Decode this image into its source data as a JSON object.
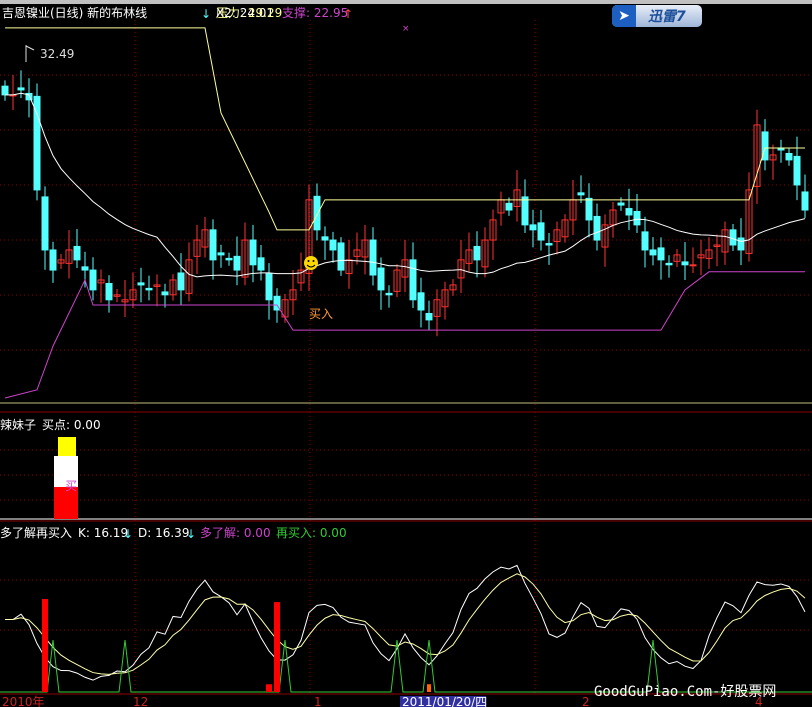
{
  "header": {
    "title": "吉恩镍业(日线) 新的布林线",
    "x2_label": "X2: 24.01",
    "pressure_label": "压力: 29.29",
    "support_label": "支撑: 22.95",
    "max_label": "32.49"
  },
  "panel2": {
    "title": "辣妹子",
    "buy_point": "买点: 0.00",
    "bar_text": "买"
  },
  "panel3": {
    "title": "多了解再买入",
    "k": "K: 16.19",
    "d": "D: 16.39",
    "dlj": "多了解: 0.00",
    "zmr": "再买入: 0.00"
  },
  "annotations": {
    "buy": "买入"
  },
  "time_axis": [
    "2010年",
    "12",
    "1",
    "2011/01/20/四",
    "2",
    "4"
  ],
  "logo": {
    "text": "迅雷7"
  },
  "watermark": "GoodGuPiao.Com-好股票网",
  "colors": {
    "up": "#ff3232",
    "down": "#54ffff",
    "ma": "#ffffff",
    "pressure": "#ffff99",
    "support": "#cc44cc",
    "grid": "#8b0000",
    "kd_green": "#33cc33"
  },
  "chart_data": {
    "type": "candlestick",
    "ylim": [
      20.38,
      33.59
    ],
    "close": [
      31.02,
      31.02,
      31.19,
      30.85,
      27.76,
      25.7,
      25.01,
      25.36,
      25.7,
      25.36,
      25.01,
      24.33,
      24.67,
      23.99,
      24.16,
      23.99,
      24.33,
      24.5,
      24.33,
      24.5,
      24.16,
      24.67,
      24.33,
      25.36,
      26.04,
      26.39,
      25.36,
      25.53,
      25.36,
      25.01,
      26.04,
      25.19,
      25.01,
      23.99,
      23.64,
      23.99,
      24.33,
      25.01,
      27.42,
      26.39,
      26.04,
      25.7,
      25.01,
      25.36,
      25.7,
      26.04,
      24.84,
      24.33,
      24.16,
      25.01,
      25.36,
      23.99,
      23.64,
      23.3,
      23.99,
      24.33,
      24.5,
      25.36,
      25.7,
      25.36,
      26.04,
      26.73,
      27.42,
      27.07,
      27.76,
      26.56,
      26.39,
      26.04,
      25.87,
      26.39,
      26.73,
      27.42,
      27.59,
      26.73,
      26.04,
      26.56,
      27.07,
      27.24,
      26.9,
      26.56,
      25.7,
      25.53,
      25.36,
      25.19,
      25.53,
      25.19,
      25.19,
      25.53,
      25.7,
      25.87,
      26.39,
      25.87,
      25.7,
      27.76,
      29.99,
      28.79,
      28.96,
      29.13,
      28.79,
      27.93,
      27.07
    ],
    "pressure_knots": [
      [
        0,
        33.32
      ],
      [
        25,
        33.32
      ],
      [
        27,
        30.4
      ],
      [
        33,
        27.0
      ],
      [
        34,
        26.39
      ],
      [
        38,
        26.39
      ],
      [
        40,
        27.42
      ],
      [
        93,
        27.42
      ],
      [
        95,
        29.2
      ],
      [
        100,
        29.2
      ]
    ],
    "support_knots": [
      [
        0,
        20.62
      ],
      [
        4,
        20.9
      ],
      [
        6,
        22.4
      ],
      [
        10,
        24.67
      ],
      [
        11,
        23.81
      ],
      [
        34,
        23.81
      ],
      [
        36,
        22.95
      ],
      [
        82,
        22.95
      ],
      [
        85,
        24.33
      ],
      [
        88,
        24.95
      ],
      [
        100,
        24.95
      ]
    ],
    "buy_index": 38,
    "kd_green_spikes": [
      6,
      15,
      35,
      49,
      53,
      81
    ],
    "kd_red_bars": [
      [
        5,
        0.6
      ],
      [
        34,
        0.58
      ],
      [
        33,
        0.05
      ]
    ],
    "kd_orange_bars": [
      [
        53,
        0.05
      ]
    ],
    "panel2_bars": {
      "yellow": [
        0.63,
        0.82
      ],
      "white": [
        0.32,
        0.63
      ],
      "red": [
        0,
        0.32
      ]
    }
  }
}
